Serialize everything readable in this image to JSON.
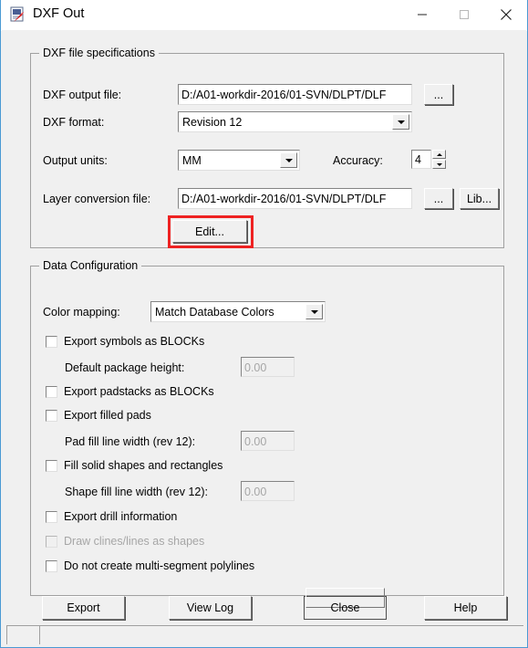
{
  "window": {
    "title": "DXF Out",
    "icon": "dxf-app-icon",
    "controls": {
      "minimize": "minimize-icon",
      "maximize": "maximize-icon",
      "close": "close-icon"
    }
  },
  "groups": {
    "dxf": {
      "title": "DXF file specifications",
      "output_file": {
        "label": "DXF output file:",
        "value": "D:/A01-workdir-2016/01-SVN/DLPT/DLF",
        "browse_label": "..."
      },
      "format": {
        "label": "DXF format:",
        "value": "Revision 12"
      },
      "units": {
        "label": "Output units:",
        "value": "MM"
      },
      "accuracy": {
        "label": "Accuracy:",
        "value": "4"
      },
      "layer_file": {
        "label": "Layer conversion file:",
        "value": "D:/A01-workdir-2016/01-SVN/DLPT/DLF",
        "browse_label": "...",
        "lib_label": "Lib..."
      },
      "edit_button": {
        "label": "Edit...",
        "highlight_color": "#ee2222"
      }
    },
    "data": {
      "title": "Data Configuration",
      "color_mapping": {
        "label": "Color mapping:",
        "value": "Match Database Colors"
      },
      "rows": [
        {
          "kind": "checkbox",
          "label": "Export symbols as BLOCKs",
          "checked": false,
          "enabled": true
        },
        {
          "kind": "field",
          "label": "Default package height:",
          "value": "0.00",
          "enabled": false
        },
        {
          "kind": "checkbox",
          "label": "Export padstacks as BLOCKs",
          "checked": false,
          "enabled": true
        },
        {
          "kind": "checkbox",
          "label": "Export filled pads",
          "checked": false,
          "enabled": true
        },
        {
          "kind": "field",
          "label": "Pad fill line width (rev 12):",
          "value": "0.00",
          "enabled": false
        },
        {
          "kind": "checkbox",
          "label": "Fill solid shapes and rectangles",
          "checked": false,
          "enabled": true
        },
        {
          "kind": "field",
          "label": "Shape fill line width (rev 12):",
          "value": "0.00",
          "enabled": false
        },
        {
          "kind": "checkbox",
          "label": "Export drill information",
          "checked": false,
          "enabled": true
        },
        {
          "kind": "checkbox",
          "label": "Draw clines/lines as shapes",
          "checked": false,
          "enabled": false
        },
        {
          "kind": "checkbox",
          "label": "Do not create multi-segment polylines",
          "checked": false,
          "enabled": true
        }
      ]
    }
  },
  "footer": {
    "export_label": "Export",
    "view_log_label": "View Log",
    "close_label": "Close",
    "help_label": "Help"
  },
  "statusbar": {
    "pane1": "",
    "pane2": ""
  }
}
